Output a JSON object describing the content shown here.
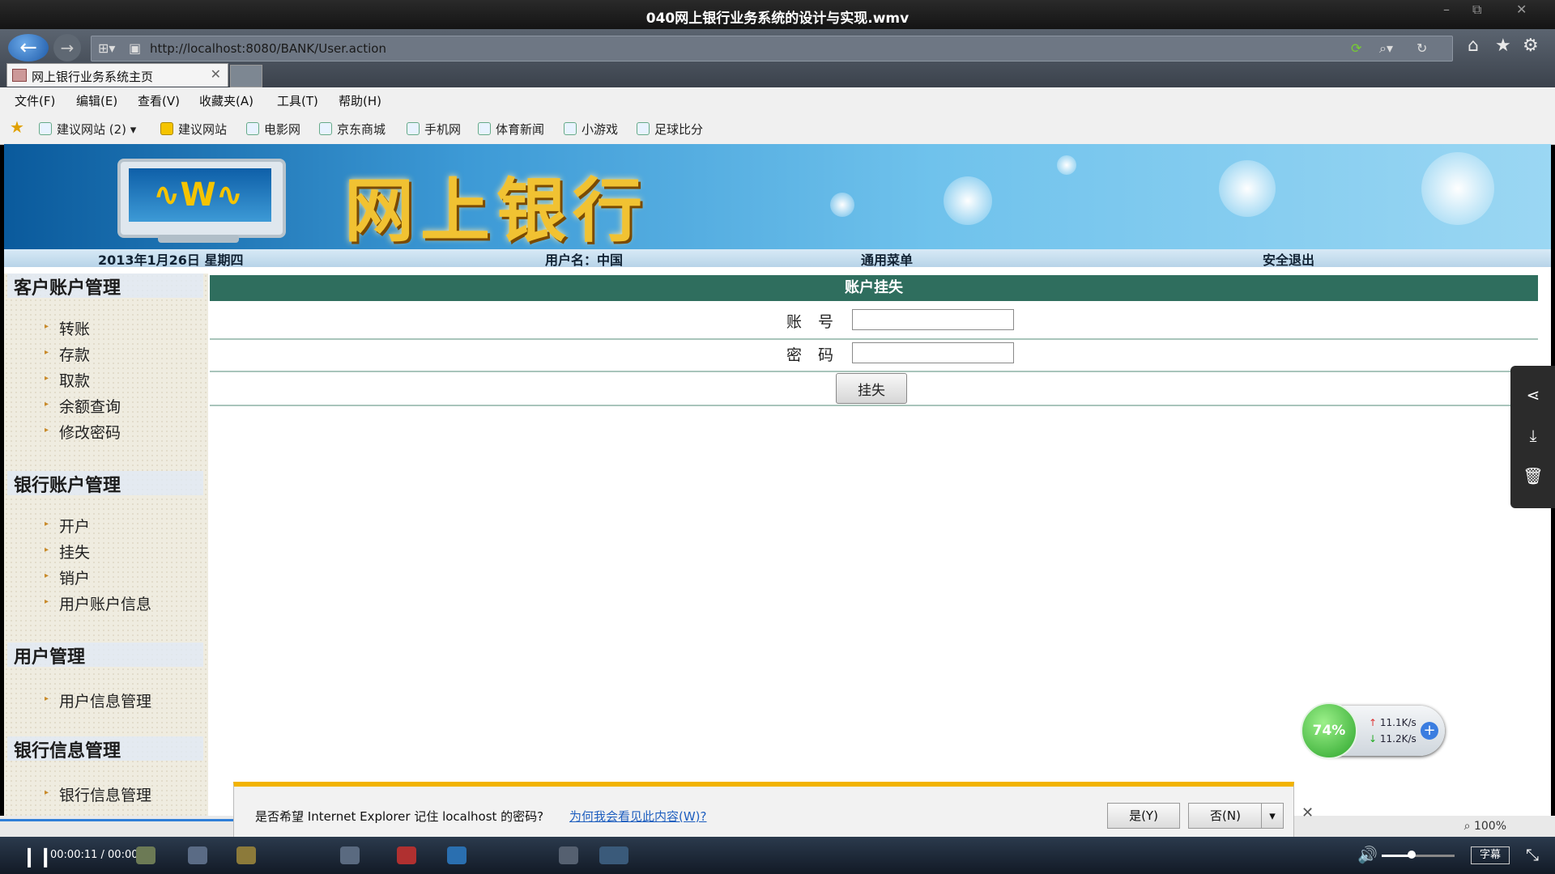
{
  "player": {
    "title": "040网上银行业务系统的设计与实现.wmv",
    "time": "00:00:11 / 00:00:27",
    "subtitle_label": "字幕",
    "progress_fraction": 0.41
  },
  "browser": {
    "address": "http://localhost:8080/BANK/User.action",
    "tab_title": "网上银行业务系统主页",
    "menu": [
      "文件(F)",
      "编辑(E)",
      "查看(V)",
      "收藏夹(A)",
      "工具(T)",
      "帮助(H)"
    ],
    "favorites": [
      "建议网站 (2)",
      "建议网站",
      "电影网",
      "京东商城",
      "手机网",
      "体育新闻",
      "小游戏",
      "足球比分"
    ],
    "zoom": "100%"
  },
  "site": {
    "banner_title": "网上银行",
    "info": {
      "date": "2013年1月26日 星期四",
      "user": "用户名：中国",
      "menu": "通用菜单",
      "logout": "安全退出"
    }
  },
  "sidebar": {
    "sections": [
      {
        "title": "客户账户管理",
        "items": [
          "转账",
          "存款",
          "取款",
          "余额查询",
          "修改密码"
        ]
      },
      {
        "title": "银行账户管理",
        "items": [
          "开户",
          "挂失",
          "销户",
          "用户账户信息"
        ]
      },
      {
        "title": "用户管理",
        "items": [
          "用户信息管理"
        ]
      },
      {
        "title": "银行信息管理",
        "items": [
          "银行信息管理"
        ]
      }
    ]
  },
  "form": {
    "heading": "账户挂失",
    "account_label": "账号",
    "password_label": "密码",
    "account_value": "",
    "password_value": "",
    "submit_label": "挂失"
  },
  "net_widget": {
    "percent": "74%",
    "up": "11.1K/s",
    "down": "11.2K/s"
  },
  "password_prompt": {
    "text": "是否希望 Internet Explorer 记住 localhost 的密码?",
    "link": "为何我会看见此内容(W)?",
    "yes": "是(Y)",
    "no": "否(N)"
  }
}
